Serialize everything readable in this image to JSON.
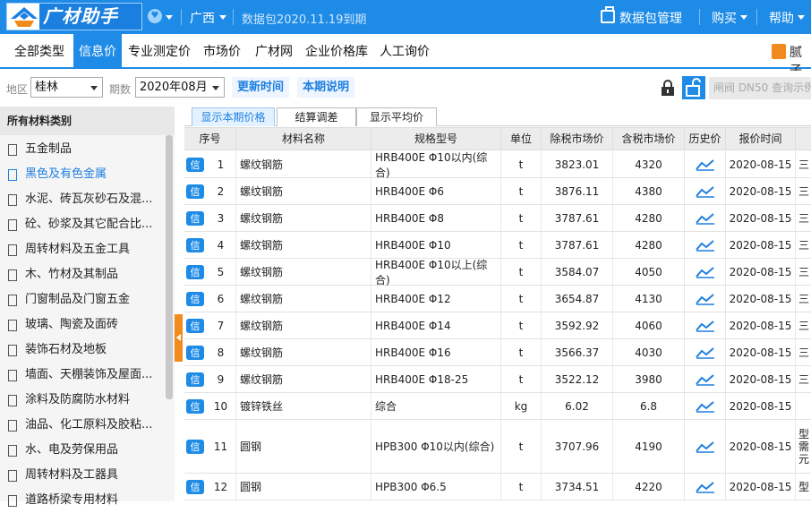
{
  "header": {
    "logo_text": "广材助手",
    "region": "广西",
    "data_package": "数据包2020.11.19到期",
    "package_mgmt": "数据包管理",
    "buy": "购买",
    "help": "帮助"
  },
  "nav": {
    "items": [
      "全部类型",
      "信息价",
      "专业测定价",
      "市场价",
      "广材网",
      "企业价格库",
      "人工询价"
    ],
    "active_index": 1,
    "right_label": "腻子"
  },
  "filters": {
    "area_label": "地区",
    "area_value": "桂林",
    "period_label": "期数",
    "period_value": "2020年08月",
    "update_time": "更新时间",
    "period_note": "本期说明",
    "search_placeholder": "闸阀 DN50 查询示例"
  },
  "sidebar": {
    "title": "所有材料类别",
    "active_index": 1,
    "items": [
      "五金制品",
      "黑色及有色金属",
      "水泥、砖瓦灰砂石及混...",
      "砼、砂浆及其它配合比...",
      "周转材料及五金工具",
      "木、竹材及其制品",
      "门窗制品及门窗五金",
      "玻璃、陶瓷及面砖",
      "装饰石材及地板",
      "墙面、天棚装饰及屋面...",
      "涂料及防腐防水材料",
      "油品、化工原料及胶粘...",
      "水、电及劳保用品",
      "周转材料及工器具",
      "道路桥梁专用材料"
    ]
  },
  "tabs": [
    "显示本期价格",
    "结算调差",
    "显示平均价"
  ],
  "table": {
    "columns": [
      "序号",
      "材料名称",
      "规格型号",
      "单位",
      "除税市场价",
      "含税市场价",
      "历史价",
      "报价时间"
    ],
    "badge": "信",
    "rows": [
      {
        "no": "1",
        "name": "螺纹钢筋",
        "spec": "HRB400E Φ10以内(综合)",
        "unit": "t",
        "pre_tax": "3823.01",
        "with_tax": "4320",
        "date": "2020-08-15",
        "extra": "三"
      },
      {
        "no": "2",
        "name": "螺纹钢筋",
        "spec": "HRB400E Φ6",
        "unit": "t",
        "pre_tax": "3876.11",
        "with_tax": "4380",
        "date": "2020-08-15",
        "extra": "三"
      },
      {
        "no": "3",
        "name": "螺纹钢筋",
        "spec": "HRB400E Φ8",
        "unit": "t",
        "pre_tax": "3787.61",
        "with_tax": "4280",
        "date": "2020-08-15",
        "extra": "三"
      },
      {
        "no": "4",
        "name": "螺纹钢筋",
        "spec": "HRB400E Φ10",
        "unit": "t",
        "pre_tax": "3787.61",
        "with_tax": "4280",
        "date": "2020-08-15",
        "extra": "三"
      },
      {
        "no": "5",
        "name": "螺纹钢筋",
        "spec": "HRB400E Φ10以上(综合)",
        "unit": "t",
        "pre_tax": "3584.07",
        "with_tax": "4050",
        "date": "2020-08-15",
        "extra": "三"
      },
      {
        "no": "6",
        "name": "螺纹钢筋",
        "spec": "HRB400E Φ12",
        "unit": "t",
        "pre_tax": "3654.87",
        "with_tax": "4130",
        "date": "2020-08-15",
        "extra": "三"
      },
      {
        "no": "7",
        "name": "螺纹钢筋",
        "spec": "HRB400E Φ14",
        "unit": "t",
        "pre_tax": "3592.92",
        "with_tax": "4060",
        "date": "2020-08-15",
        "extra": "三"
      },
      {
        "no": "8",
        "name": "螺纹钢筋",
        "spec": "HRB400E Φ16",
        "unit": "t",
        "pre_tax": "3566.37",
        "with_tax": "4030",
        "date": "2020-08-15",
        "extra": "三"
      },
      {
        "no": "9",
        "name": "螺纹钢筋",
        "spec": "HRB400E Φ18-25",
        "unit": "t",
        "pre_tax": "3522.12",
        "with_tax": "3980",
        "date": "2020-08-15",
        "extra": "三"
      },
      {
        "no": "10",
        "name": "镀锌铁丝",
        "spec": "综合",
        "unit": "kg",
        "pre_tax": "6.02",
        "with_tax": "6.8",
        "date": "2020-08-15",
        "extra": ""
      },
      {
        "no": "11",
        "name": "圆钢",
        "spec": "HPB300 Φ10以内(综合)",
        "unit": "t",
        "pre_tax": "3707.96",
        "with_tax": "4190",
        "date": "2020-08-15",
        "extra": "型\n需\n元"
      },
      {
        "no": "12",
        "name": "圆钢",
        "spec": "HPB300 Φ6.5",
        "unit": "t",
        "pre_tax": "3734.51",
        "with_tax": "4220",
        "date": "2020-08-15",
        "extra": "型"
      }
    ]
  }
}
